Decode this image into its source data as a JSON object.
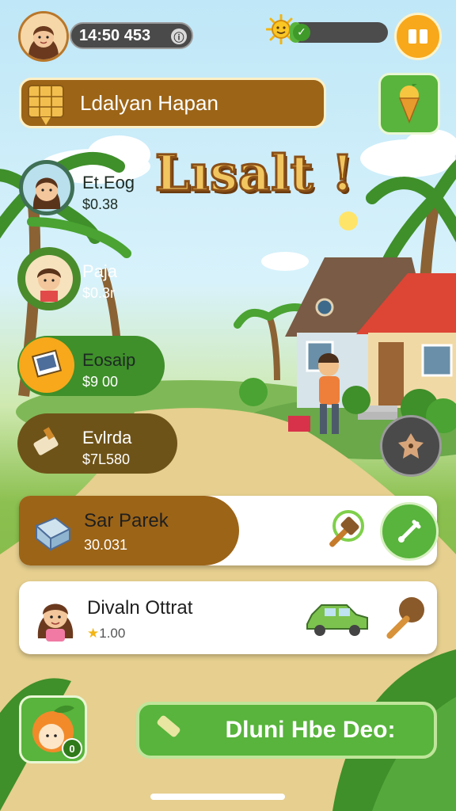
{
  "top_bar": {
    "timer_text": "14:50 453",
    "info_icon": "info-icon",
    "energy_level": 0.12
  },
  "banner": {
    "title": "Ldalyan Hapan"
  },
  "big_title": "Lısalt !",
  "side_list": [
    {
      "name": "Et.Eog",
      "price": "$0.38",
      "color": "#3f6f55"
    },
    {
      "name": "Paja",
      "price": "$0.3r",
      "color": "#4a8b2c"
    },
    {
      "name": "Eosaip",
      "price": "$9 00",
      "color": "#4a8b2c"
    },
    {
      "name": "Evlrda",
      "price": "$7L580",
      "color": "#6e5318"
    }
  ],
  "cards": [
    {
      "name": "Sar Parek",
      "value": "30.031"
    },
    {
      "name": "Divaln Ottrat",
      "value": "1.00"
    }
  ],
  "cta": {
    "label": "Dluni Hbe Deo:"
  },
  "corner_badge": "0",
  "colors": {
    "accent_green": "#58b43c",
    "brown": "#9c6417",
    "orange": "#f7a81b"
  }
}
